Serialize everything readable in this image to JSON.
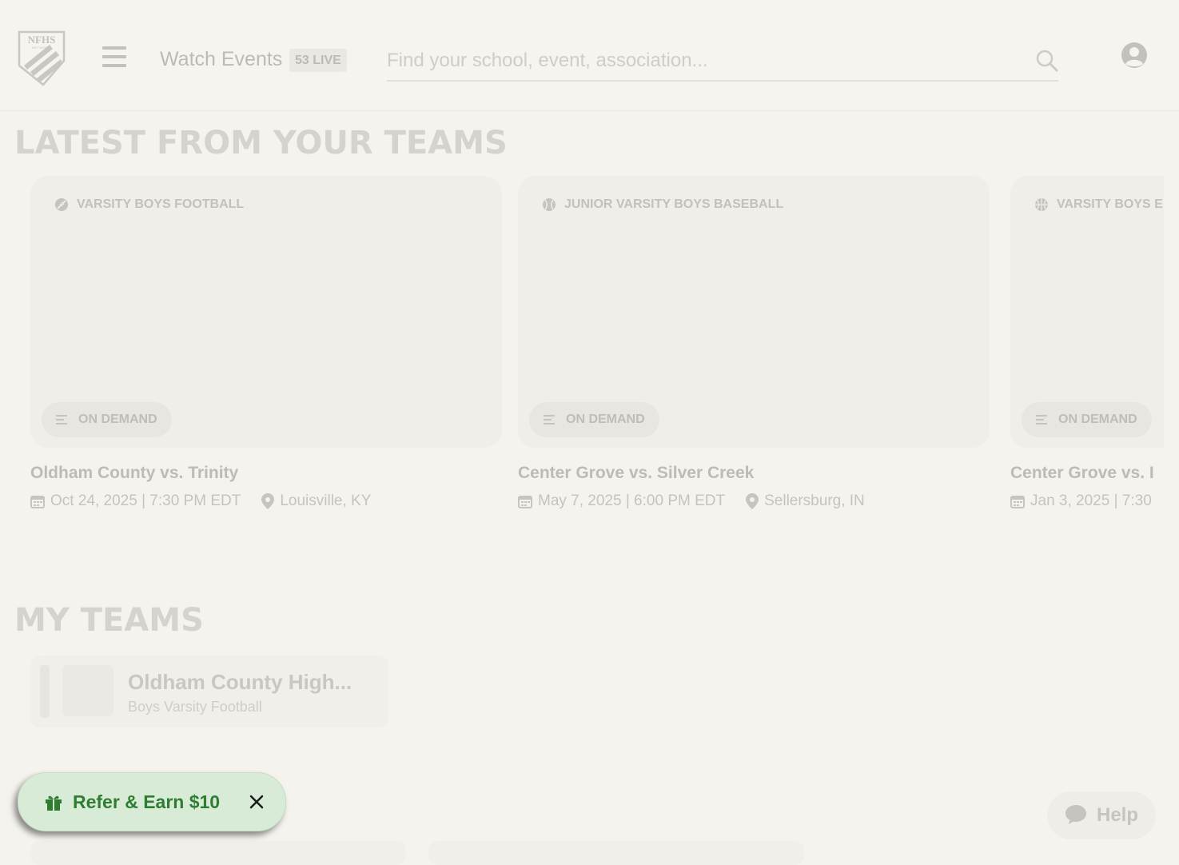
{
  "header": {
    "logo_text": "NFHS",
    "logo_subtext": "NETWORK",
    "watch_label": "Watch Events",
    "live_count": "53 LIVE",
    "search_placeholder": "Find your school, event, association..."
  },
  "latest": {
    "title": "LATEST FROM YOUR TEAMS",
    "cards": [
      {
        "sport": "VARSITY BOYS FOOTBALL",
        "sport_icon": "football-icon",
        "status": "ON DEMAND",
        "title": "Oldham County vs. Trinity",
        "date": "Oct 24, 2025 | 7:30 PM EDT",
        "location": "Louisville, KY"
      },
      {
        "sport": "JUNIOR VARSITY BOYS BASEBALL",
        "sport_icon": "baseball-icon",
        "status": "ON DEMAND",
        "title": "Center Grove vs. Silver Creek",
        "date": "May 7, 2025 | 6:00 PM EDT",
        "location": "Sellersburg, IN"
      },
      {
        "sport": "VARSITY BOYS E",
        "sport_icon": "basketball-icon",
        "status": "ON DEMAND",
        "title": "Center Grove vs. I",
        "date": "Jan 3, 2025 | 7:30",
        "location": ""
      }
    ]
  },
  "my_teams": {
    "title": "MY TEAMS",
    "teams": [
      {
        "name": "Oldham County High...",
        "subtitle": "Boys Varsity Football"
      }
    ]
  },
  "refer": {
    "label": "Refer & Earn $10",
    "accent": "#2e7d32",
    "background": "#d8ebd7"
  },
  "help": {
    "label": "Help"
  }
}
